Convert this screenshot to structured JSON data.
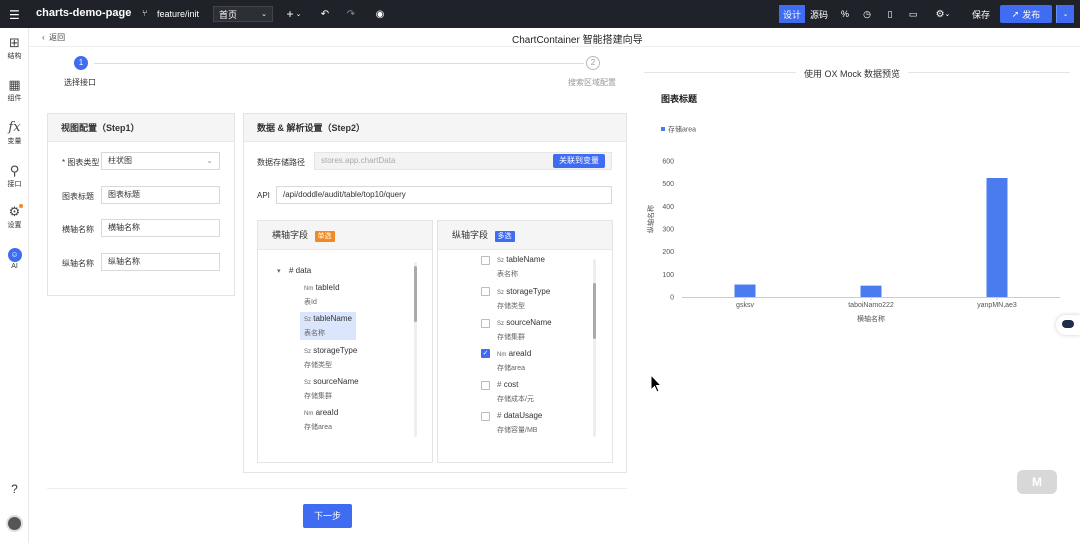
{
  "topbar": {
    "project": "charts-demo-page",
    "branch": "feature/init",
    "page_select": "首页",
    "add": "+",
    "design_tab": "设计",
    "source_tab": "源码",
    "save": "保存",
    "publish": "发布"
  },
  "leftbar": {
    "structure": "结构",
    "components": "组件",
    "variables": "变量",
    "interfaces": "接口",
    "settings": "设置",
    "ai": "AI"
  },
  "wizard": {
    "back": "返回",
    "title": "ChartContainer 智能搭建向导",
    "steps": [
      {
        "num": "1",
        "label": "选择接口"
      },
      {
        "num": "2",
        "label": "搜索区域配置"
      }
    ],
    "next_button": "下一步"
  },
  "view_config": {
    "title": "视图配置（Step1）",
    "chart_type_label": "* 图表类型",
    "chart_type_value": "柱状图",
    "chart_title_label": "图表标题",
    "chart_title_value": "图表标题",
    "xname_label": "横轴名称",
    "xname_value": "横轴名称",
    "yname_label": "纵轴名称",
    "yname_value": "纵轴名称"
  },
  "data_config": {
    "title": "数据 & 解析设置（Step2）",
    "path_label": "数据存储路径",
    "path_placeholder": "stores.app.chartData",
    "bind_button": "关联到变量",
    "api_label": "API",
    "api_value": "/api/doddle/audit/table/top10/query"
  },
  "x_field": {
    "title": "横轴字段",
    "badge": "单选",
    "root": "# data",
    "items": [
      {
        "type": "Nm",
        "name": "tableId",
        "desc": "表Id"
      },
      {
        "type": "Sz",
        "name": "tableName",
        "desc": "表名称"
      },
      {
        "type": "Sz",
        "name": "storageType",
        "desc": "存储类型"
      },
      {
        "type": "Sz",
        "name": "sourceName",
        "desc": "存储集群"
      },
      {
        "type": "Nm",
        "name": "areaId",
        "desc": "存储area"
      }
    ]
  },
  "y_field": {
    "title": "纵轴字段",
    "badge": "多选",
    "items": [
      {
        "type": "Sz",
        "name": "tableName",
        "desc": "表名称"
      },
      {
        "type": "Sz",
        "name": "storageType",
        "desc": "存储类型"
      },
      {
        "type": "Sz",
        "name": "sourceName",
        "desc": "存储集群"
      },
      {
        "type": "Nm",
        "name": "areaId",
        "desc": "存储area"
      },
      {
        "type": "#",
        "name": "cost",
        "desc": "存储成本/元"
      },
      {
        "type": "#",
        "name": "dataUsage",
        "desc": "存储容量/MB"
      }
    ]
  },
  "preview": {
    "header": "使用 OX Mock 数据预览",
    "chart_title": "图表标题"
  },
  "chart_data": {
    "type": "bar",
    "title": "图表标题",
    "categories": [
      "gsksv",
      "taboiNamo222",
      "yanpMN,ae3"
    ],
    "series": [
      {
        "name": "存储area",
        "values": [
          55,
          50,
          525
        ]
      }
    ],
    "xlabel": "横轴名称",
    "ylabel": "纵轴名称",
    "ylim": [
      0,
      600
    ],
    "yticks": [
      0,
      100,
      200,
      300,
      400,
      500,
      600
    ],
    "color": "#4a7cf0",
    "legend": "top-left",
    "grid": false
  }
}
